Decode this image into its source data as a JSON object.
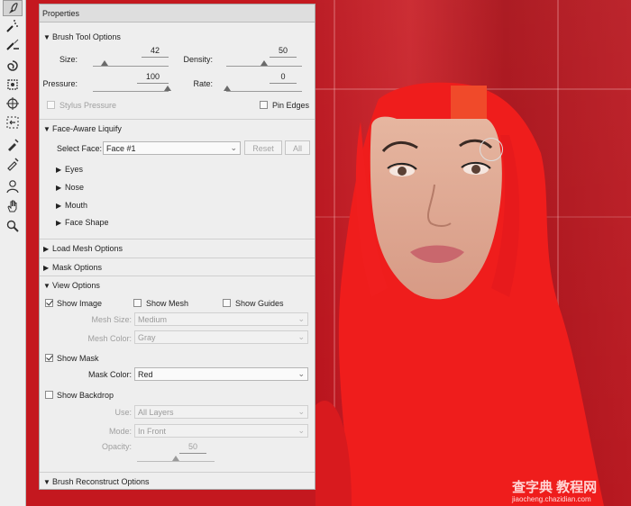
{
  "colors": {
    "panel_bg": "#eeeeee",
    "mask_red": "#f01e1e",
    "background_red": "#c4181f"
  },
  "toolbar": {
    "tools": [
      {
        "name": "forward-warp-tool-icon",
        "active": true
      },
      {
        "name": "reconstruct-tool-icon"
      },
      {
        "name": "smooth-tool-icon"
      },
      {
        "name": "twirl-clockwise-tool-icon"
      },
      {
        "name": "pucker-tool-icon"
      },
      {
        "name": "bloat-tool-icon"
      },
      {
        "name": "push-left-tool-icon"
      },
      {
        "name": "freeze-mask-tool-icon"
      },
      {
        "name": "thaw-mask-tool-icon"
      },
      {
        "name": "face-tool-icon"
      },
      {
        "name": "hand-tool-icon"
      },
      {
        "name": "zoom-tool-icon"
      }
    ]
  },
  "panel": {
    "title": "Properties",
    "brush_tool_options": {
      "header": "Brush Tool Options",
      "size_label": "Size:",
      "size_value": "42",
      "density_label": "Density:",
      "density_value": "50",
      "pressure_label": "Pressure:",
      "pressure_value": "100",
      "rate_label": "Rate:",
      "rate_value": "0",
      "stylus_pressure_label": "Stylus Pressure",
      "pin_edges_label": "Pin Edges"
    },
    "face_aware_liquify": {
      "header": "Face-Aware Liquify",
      "select_face_label": "Select Face:",
      "select_face_value": "Face #1",
      "reset_label": "Reset",
      "all_label": "All",
      "items": [
        "Eyes",
        "Nose",
        "Mouth",
        "Face Shape"
      ]
    },
    "load_mesh_options": {
      "header": "Load Mesh Options"
    },
    "mask_options": {
      "header": "Mask Options"
    },
    "view_options": {
      "header": "View Options",
      "show_image_label": "Show Image",
      "show_mesh_label": "Show Mesh",
      "show_guides_label": "Show Guides",
      "mesh_size_label": "Mesh Size:",
      "mesh_size_value": "Medium",
      "mesh_color_label": "Mesh Color:",
      "mesh_color_value": "Gray",
      "show_mask_label": "Show Mask",
      "mask_color_label": "Mask Color:",
      "mask_color_value": "Red",
      "show_backdrop_label": "Show Backdrop",
      "use_label": "Use:",
      "use_value": "All Layers",
      "mode_label": "Mode:",
      "mode_value": "In Front",
      "opacity_label": "Opacity:",
      "opacity_value": "50"
    },
    "brush_reconstruct_options": {
      "header": "Brush Reconstruct Options"
    }
  },
  "watermark": {
    "text": "查字典 教程网",
    "url": "jiaocheng.chazidian.com"
  }
}
